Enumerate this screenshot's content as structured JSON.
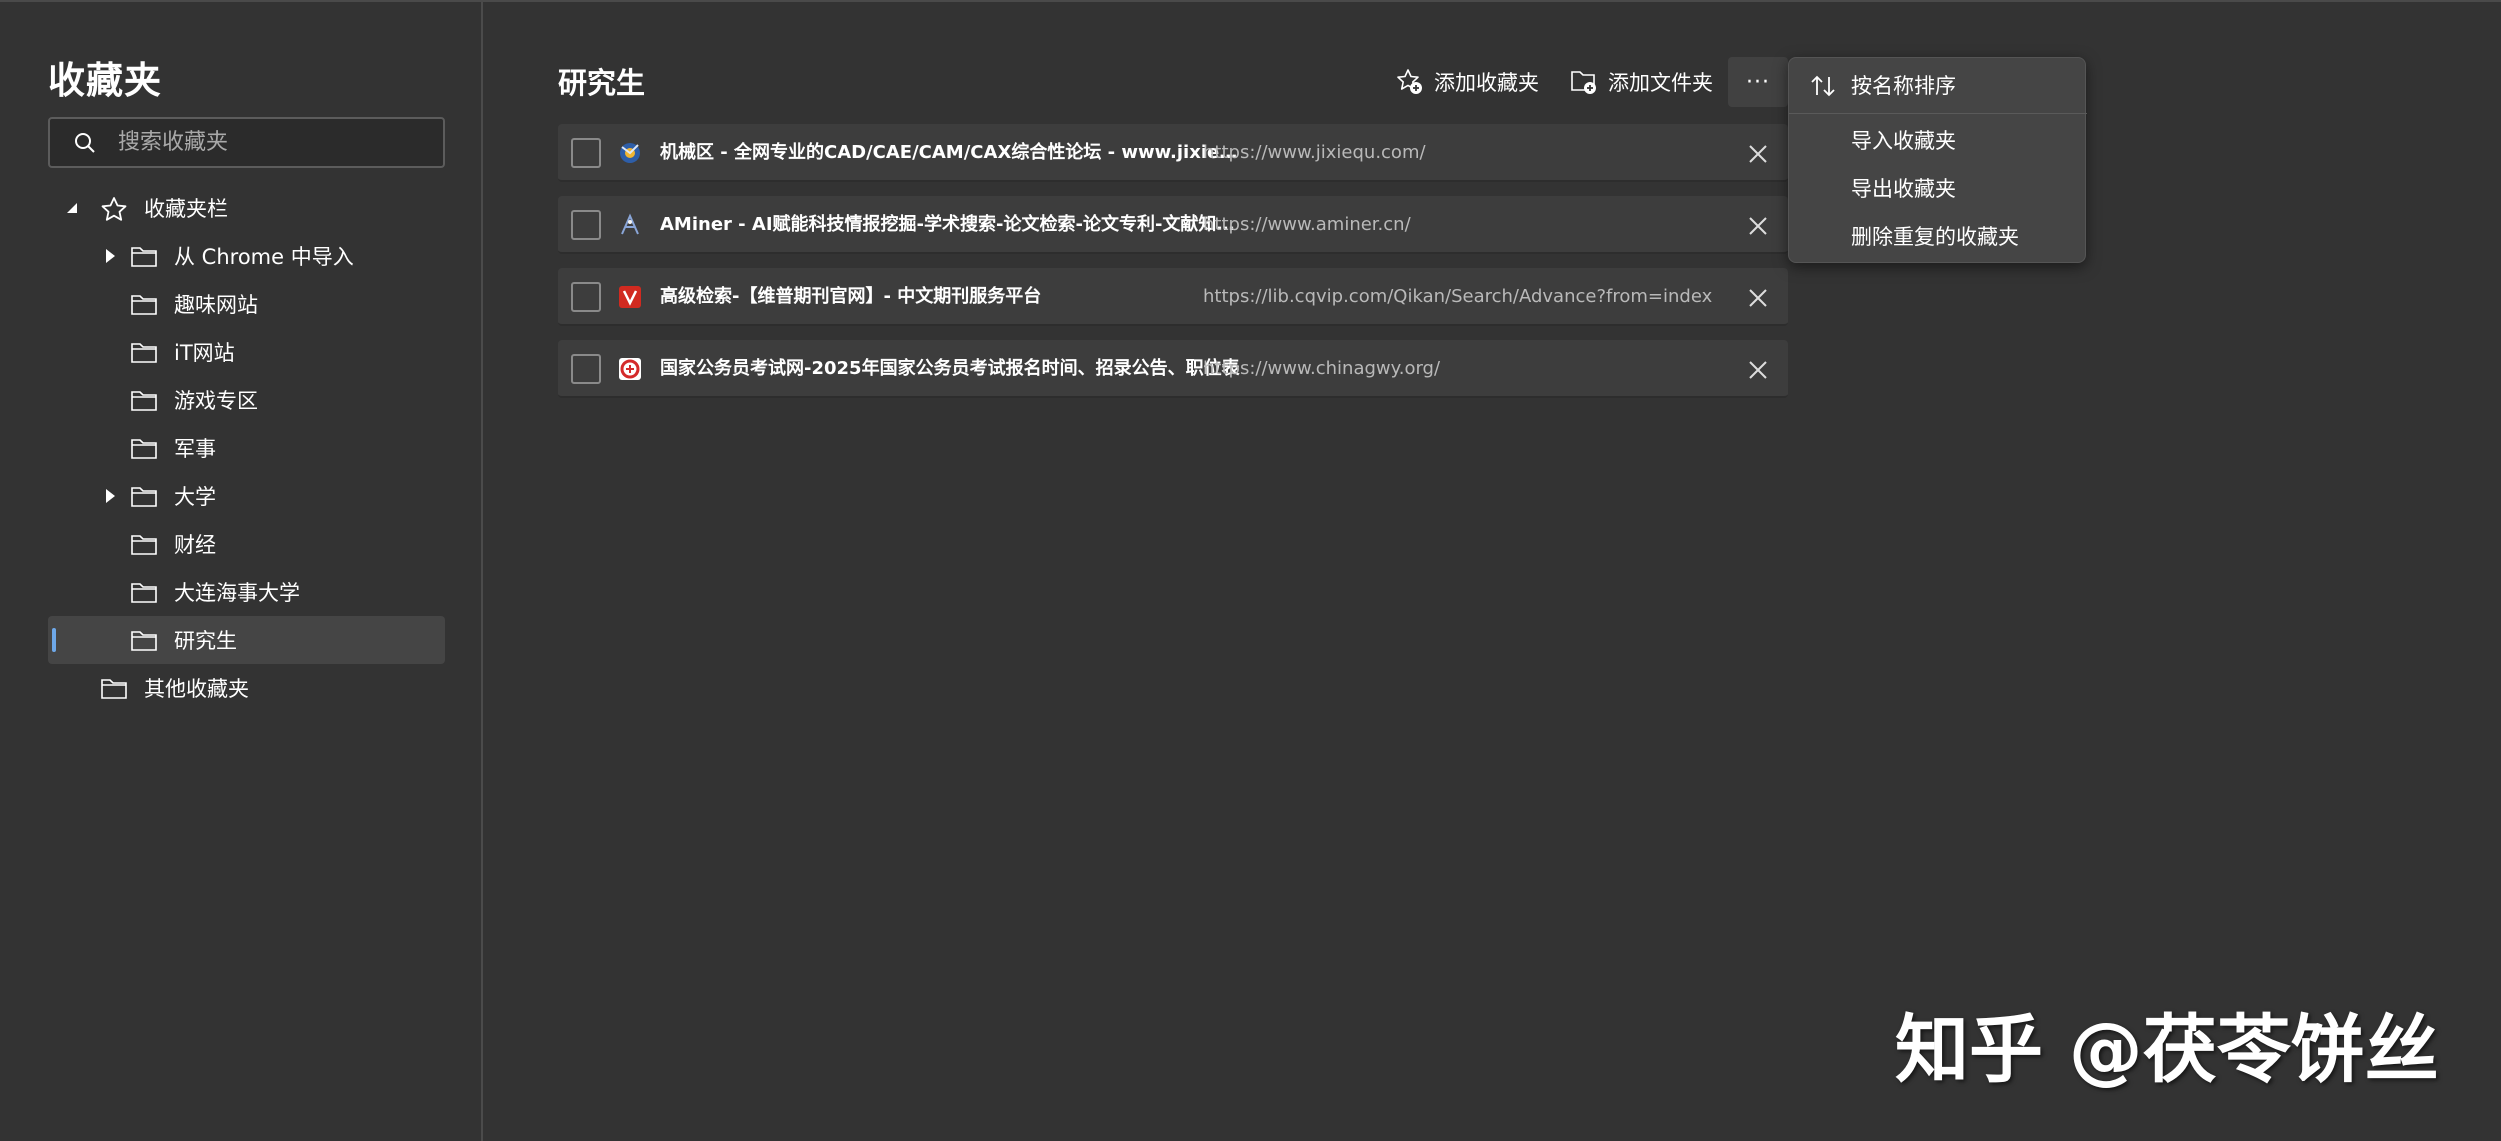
{
  "sidebar": {
    "title": "收藏夹",
    "search_placeholder": "搜索收藏夹",
    "tree": [
      {
        "label": "收藏夹栏",
        "icon": "star-icon",
        "expanded": true
      },
      {
        "label": "从 Chrome 中导入",
        "icon": "folder-icon",
        "collapsed": true
      },
      {
        "label": "趣味网站",
        "icon": "folder-icon"
      },
      {
        "label": "iT网站",
        "icon": "folder-icon"
      },
      {
        "label": "游戏专区",
        "icon": "folder-icon"
      },
      {
        "label": "军事",
        "icon": "folder-icon"
      },
      {
        "label": "大学",
        "icon": "folder-icon",
        "collapsed": true
      },
      {
        "label": "财经",
        "icon": "folder-icon"
      },
      {
        "label": "大连海事大学",
        "icon": "folder-icon"
      },
      {
        "label": "研究生",
        "icon": "folder-icon",
        "selected": true
      },
      {
        "label": "其他收藏夹",
        "icon": "folder-icon"
      }
    ]
  },
  "main": {
    "title": "研究生",
    "toolbar": {
      "add_favorite": "添加收藏夹",
      "add_folder": "添加文件夹",
      "more": "···"
    },
    "bookmarks": [
      {
        "title": "机械区 - 全网专业的CAD/CAE/CAM/CAX综合性论坛 - www.jixiequ.com",
        "url": "https://www.jixiequ.com/",
        "favicon": "jixiequ-favicon"
      },
      {
        "title": "AMiner - AI赋能科技情报挖掘-学术搜索-论文检索-论文专利-文献知识图谱",
        "url": "https://www.aminer.cn/",
        "favicon": "aminer-favicon"
      },
      {
        "title": "高级检索-【维普期刊官网】- 中文期刊服务平台",
        "url": "https://lib.cqvip.com/Qikan/Search/Advance?from=index",
        "favicon": "cqvip-favicon"
      },
      {
        "title": "国家公务员考试网-2025年国家公务员考试报名时间、招录公告、职位表",
        "url": "https://www.chinagwy.org/",
        "favicon": "chinagwy-favicon"
      }
    ]
  },
  "menu": {
    "items": [
      "按名称排序",
      "导入收藏夹",
      "导出收藏夹",
      "删除重复的收藏夹"
    ]
  },
  "watermark": "知乎 @茯苓饼丝",
  "colors": {
    "background": "#333333",
    "selected_row": "#454545",
    "accent": "#6ea8e8",
    "row": "#3d3d3d"
  }
}
